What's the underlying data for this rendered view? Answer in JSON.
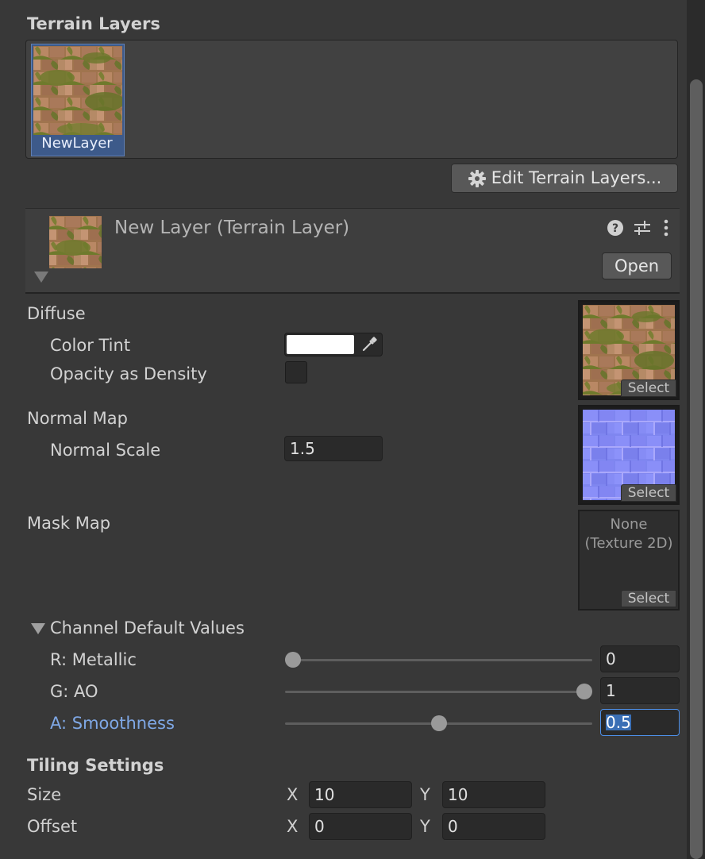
{
  "terrain_layers": {
    "heading": "Terrain Layers",
    "layers": [
      {
        "name": "NewLayer"
      }
    ],
    "edit_button_label": "Edit Terrain Layers..."
  },
  "layer_header": {
    "title": "New Layer (Terrain Layer)",
    "open_button_label": "Open"
  },
  "diffuse": {
    "heading": "Diffuse",
    "color_tint_label": "Color Tint",
    "color_tint_value": "#ffffff",
    "opacity_label": "Opacity as Density",
    "select_label": "Select"
  },
  "normal_map": {
    "heading": "Normal Map",
    "scale_label": "Normal Scale",
    "scale_value": "1.5",
    "select_label": "Select"
  },
  "mask_map": {
    "heading": "Mask Map",
    "none_line1": "None",
    "none_line2": "(Texture 2D)",
    "select_label": "Select"
  },
  "channels": {
    "heading": "Channel Default Values",
    "rows": [
      {
        "label": "R: Metallic",
        "value": "0",
        "fraction": 0.0
      },
      {
        "label": "G: AO",
        "value": "1",
        "fraction": 1.0
      },
      {
        "label": "A: Smoothness",
        "value": "0.5",
        "fraction": 0.5
      }
    ]
  },
  "tiling": {
    "heading": "Tiling Settings",
    "size_label": "Size",
    "offset_label": "Offset",
    "x_label": "X",
    "y_label": "Y",
    "size_x": "10",
    "size_y": "10",
    "offset_x": "0",
    "offset_y": "0"
  },
  "colors": {
    "background": "#383838",
    "accent": "#4d8fe8",
    "focused_label": "#7fa8e6"
  }
}
